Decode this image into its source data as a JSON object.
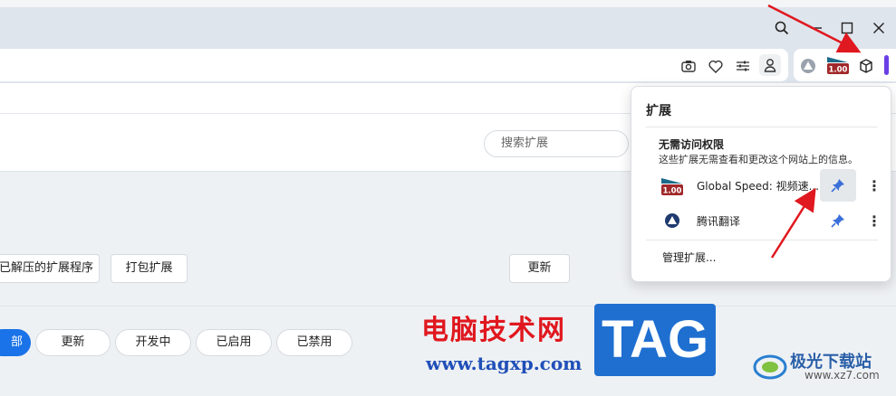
{
  "toolbar": {
    "window_controls": [
      "search-icon",
      "minimize-icon",
      "maximize-icon",
      "close-icon"
    ],
    "address_icons": [
      "camera-icon",
      "heart-icon",
      "sliders-icon",
      "profile-icon"
    ],
    "extension_icons": [
      "tencent-translate-icon",
      "global-speed-icon",
      "extensions-puzzle-icon"
    ],
    "global_speed_badge": "1.00",
    "accent": "#6b3fe6"
  },
  "page": {
    "search_placeholder": "搜索扩展",
    "buttons": {
      "load_unpacked": "已解压的扩展程序",
      "pack": "打包扩展",
      "update": "更新"
    },
    "filters": [
      {
        "label": "部",
        "active": true
      },
      {
        "label": "更新",
        "active": false
      },
      {
        "label": "开发中",
        "active": false
      },
      {
        "label": "已启用",
        "active": false
      },
      {
        "label": "已禁用",
        "active": false
      }
    ]
  },
  "popup": {
    "title": "扩展",
    "section_title": "无需访问权限",
    "section_desc": "这些扩展无需查看和更改这个网站上的信息。",
    "extensions": [
      {
        "name": "Global Speed: 视频速...",
        "badge": "1.00"
      },
      {
        "name": "腾讯翻译"
      }
    ],
    "manage": "管理扩展..."
  },
  "watermarks": {
    "site_cn": "电脑技术网",
    "site_url": "www.tagxp.com",
    "tag": "TAG",
    "right_cn": "极光下载站",
    "right_url": "www.xz7.com"
  },
  "colors": {
    "arrow": "#e0181f",
    "primary": "#1a73e8",
    "pin": "#3b6fd8"
  }
}
